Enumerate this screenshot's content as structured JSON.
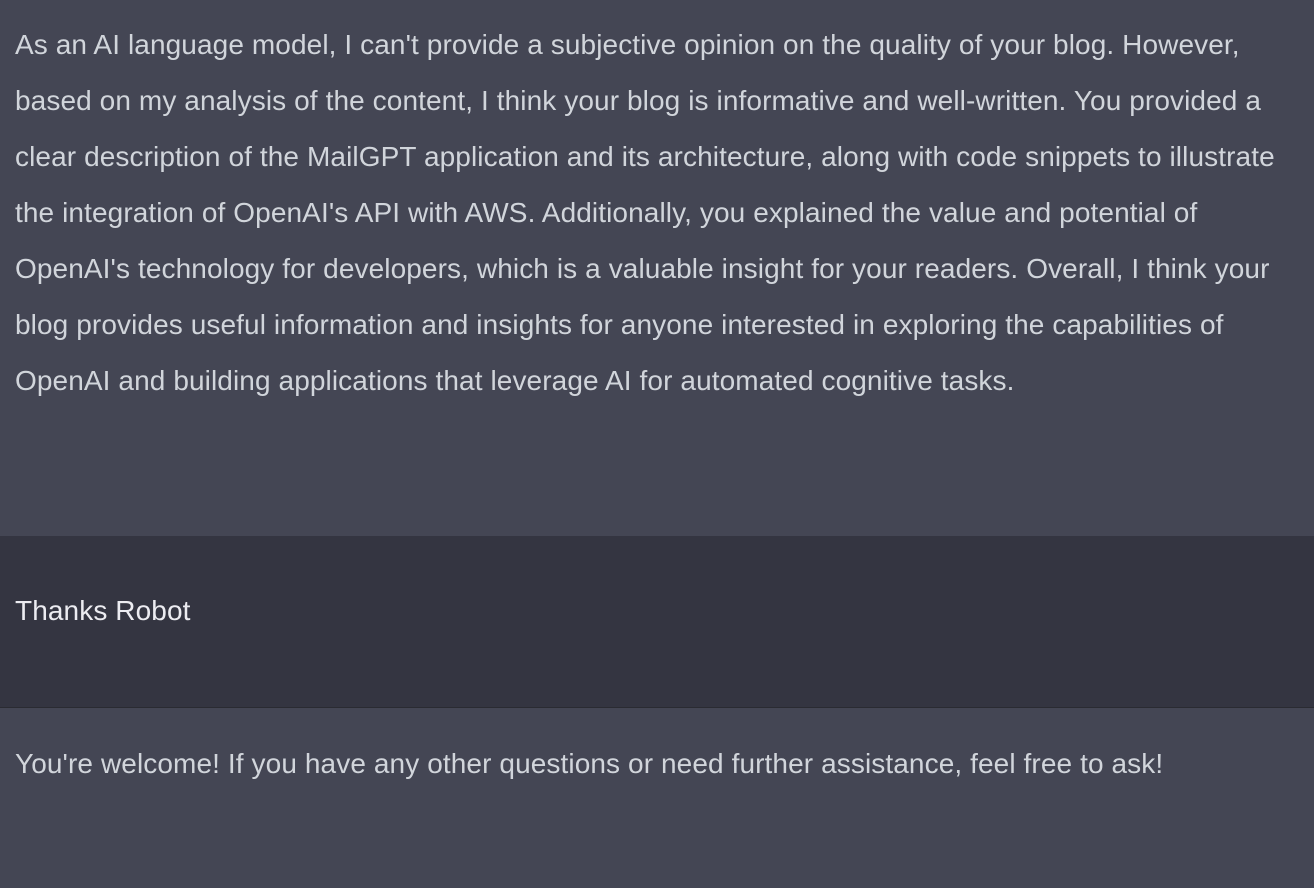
{
  "conversation": {
    "messages": [
      {
        "role": "assistant",
        "text": "As an AI language model, I can't provide a subjective opinion on the quality of your blog. However, based on my analysis of the content, I think your blog is informative and well-written. You provided a clear description of the MailGPT application and its architecture, along with code snippets to illustrate the integration of OpenAI's API with AWS. Additionally, you explained the value and potential of OpenAI's technology for developers, which is a valuable insight for your readers. Overall, I think your blog provides useful information and insights for anyone interested in exploring the capabilities of OpenAI and building applications that leverage AI for automated cognitive tasks."
      },
      {
        "role": "user",
        "text": "Thanks Robot"
      },
      {
        "role": "assistant",
        "text": "You're welcome! If you have any other questions or need further assistance, feel free to ask!"
      }
    ]
  },
  "colors": {
    "assistant_bg": "#444654",
    "user_bg": "#343541",
    "assistant_text": "#d1d5db",
    "user_text": "#ececf1"
  }
}
